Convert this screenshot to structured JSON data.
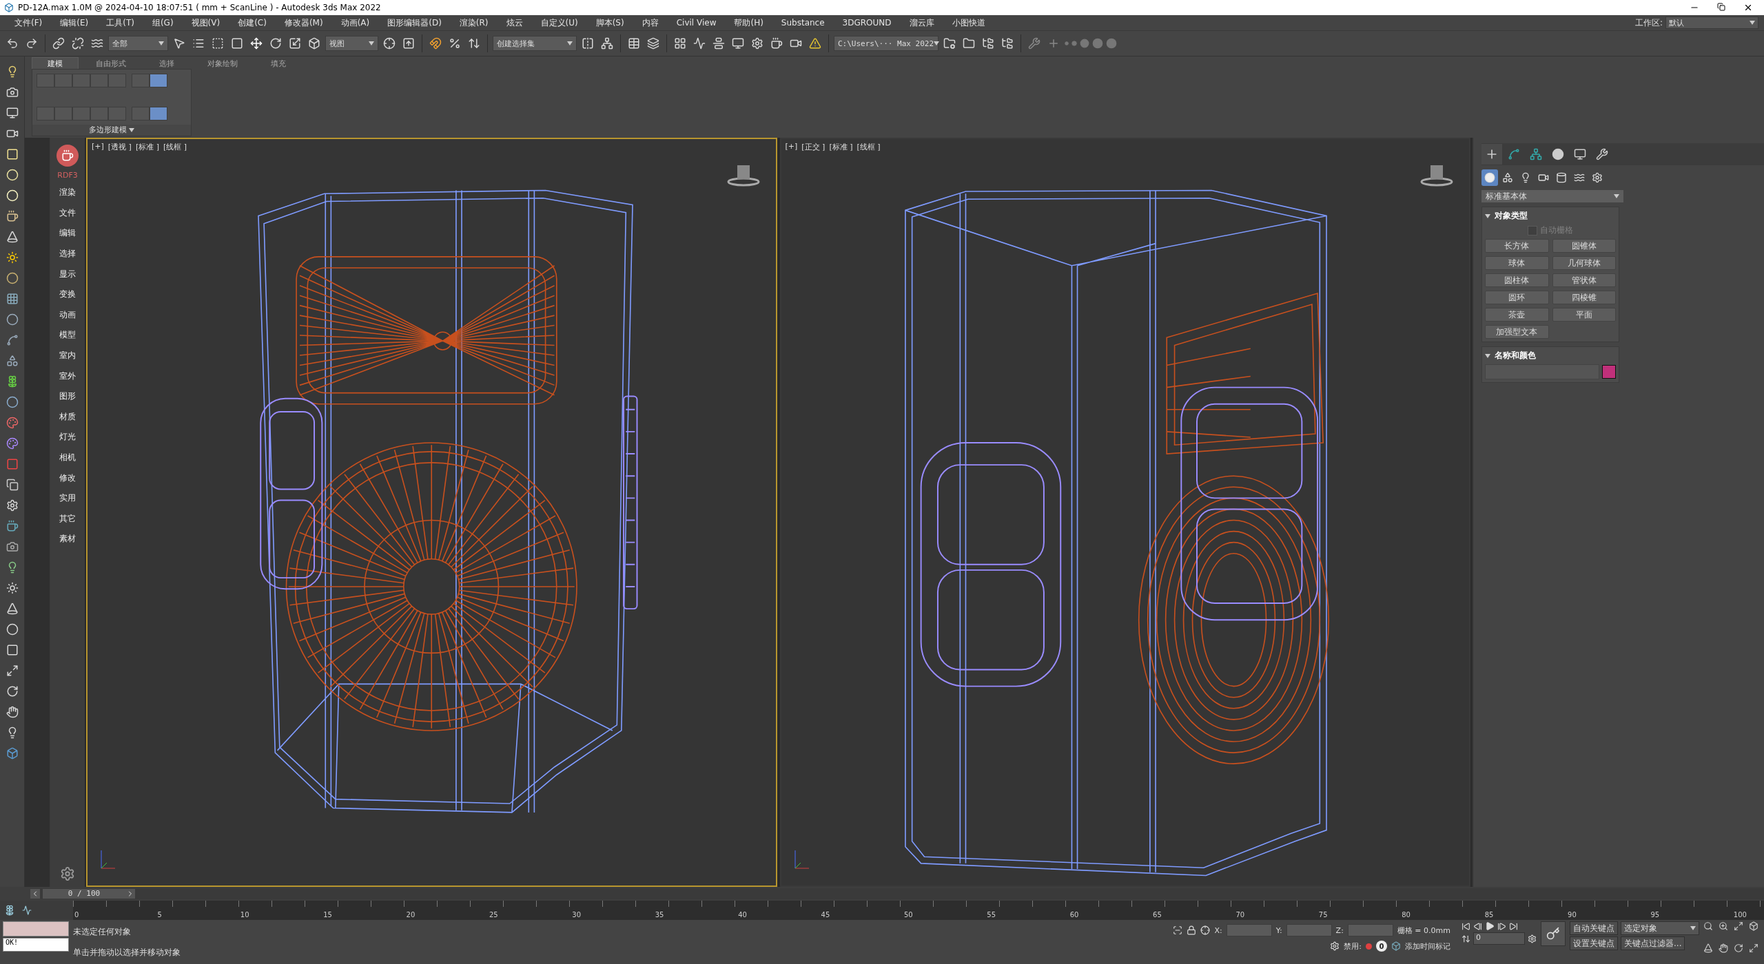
{
  "window": {
    "title": "PD-12A.max  1.0M @ 2024-04-10 18:07:51  ( mm + ScanLine ) - Autodesk 3ds Max 2022"
  },
  "menu": [
    "文件(F)",
    "编辑(E)",
    "工具(T)",
    "组(G)",
    "视图(V)",
    "创建(C)",
    "修改器(M)",
    "动画(A)",
    "图形编辑器(D)",
    "渲染(R)",
    "炫云",
    "自定义(U)",
    "脚本(S)",
    "内容",
    "Civil View",
    "帮助(H)",
    "Substance",
    "3DGROUND",
    "溜云库",
    "小图快道"
  ],
  "workspace": {
    "label": "工作区:",
    "value": "默认"
  },
  "toolbar": {
    "dropdowns": [
      "全部",
      "视图",
      "创建选择集",
      "C:\\Users\\··· Max 2022"
    ]
  },
  "ribbon": {
    "tabs": [
      {
        "label": "建模",
        "selected": true
      },
      {
        "label": "自由形式",
        "selected": false
      },
      {
        "label": "选择",
        "selected": false
      },
      {
        "label": "对象绘制",
        "selected": false
      },
      {
        "label": "填充",
        "selected": false
      }
    ],
    "panel_label": "多边形建模"
  },
  "plugin_sidebar": {
    "logo_label": "RDF3",
    "items": [
      "渲染",
      "文件",
      "编辑",
      "选择",
      "显示",
      "变换",
      "动画",
      "模型",
      "室内",
      "室外",
      "图形",
      "材质",
      "灯光",
      "相机",
      "修改",
      "实用",
      "其它",
      "素材"
    ]
  },
  "viewports": [
    {
      "labels": [
        "[+]",
        "[透视 ]",
        "[标准 ]",
        "[线框 ]"
      ],
      "selected": true,
      "kind": "front"
    },
    {
      "labels": [
        "[+]",
        "[正交 ]",
        "[标准 ]",
        "[线框 ]"
      ],
      "selected": false,
      "kind": "side"
    }
  ],
  "command_panel": {
    "dropdown": "标准基本体",
    "object_type": {
      "title": "对象类型",
      "autogrid": {
        "label": "自动栅格",
        "checked": false,
        "disabled": true
      },
      "buttons": [
        "长方体",
        "圆锥体",
        "球体",
        "几何球体",
        "圆柱体",
        "管状体",
        "圆环",
        "四棱锥",
        "茶壶",
        "平面",
        "加强型文本"
      ]
    },
    "name_color": {
      "title": "名称和颜色",
      "color": "#c0307a"
    }
  },
  "timeline": {
    "slider": "0 / 100",
    "level": 0,
    "labels": [
      "0",
      "5",
      "10",
      "15",
      "20",
      "25",
      "30",
      "35",
      "40",
      "45",
      "50",
      "55",
      "60",
      "65",
      "70",
      "75",
      "80",
      "85",
      "90",
      "95",
      "100"
    ]
  },
  "status": {
    "listener": "OK!",
    "message": "未选定任何对象",
    "prompt": "单击并拖动以选择并移动对象",
    "x_label": "X:",
    "y_label": "Y:",
    "z_label": "Z:",
    "grid": "栅格 = 0.0mm",
    "disabled_label": "禁用:",
    "counter": "0",
    "add_time_tag": "添加时间标记",
    "frame": "0",
    "auto_key": "自动关键点",
    "key_target": "选定对象",
    "set_key": "设置关键点",
    "key_filters": "关键点过滤器..."
  }
}
